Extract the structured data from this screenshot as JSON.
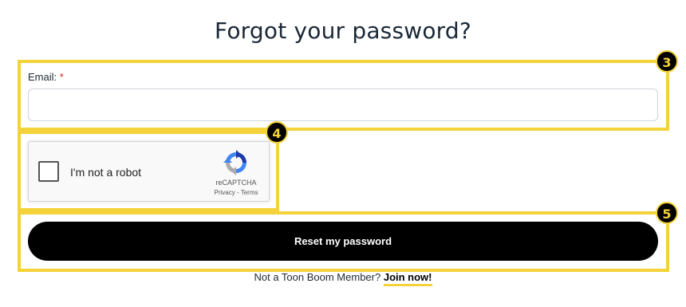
{
  "page": {
    "title": "Forgot your password?"
  },
  "form": {
    "email_label": "Email:",
    "email_required_marker": "*",
    "email_value": "",
    "email_placeholder": "",
    "reset_button_label": "Reset my password"
  },
  "recaptcha": {
    "checkbox_label": "I'm not a robot",
    "checked": false,
    "brand": "reCAPTCHA",
    "privacy_link": "Privacy",
    "separator": " - ",
    "terms_link": "Terms",
    "logo_icon": "recaptcha-logo-icon"
  },
  "footer": {
    "prompt": "Not a Toon Boom Member?",
    "join_link": "Join now!"
  },
  "annotations": [
    {
      "number": "3"
    },
    {
      "number": "4"
    },
    {
      "number": "5"
    }
  ],
  "colors": {
    "annotation": "#f4d23a",
    "button": "#000000",
    "required": "#e02424",
    "title": "#1b2837"
  }
}
